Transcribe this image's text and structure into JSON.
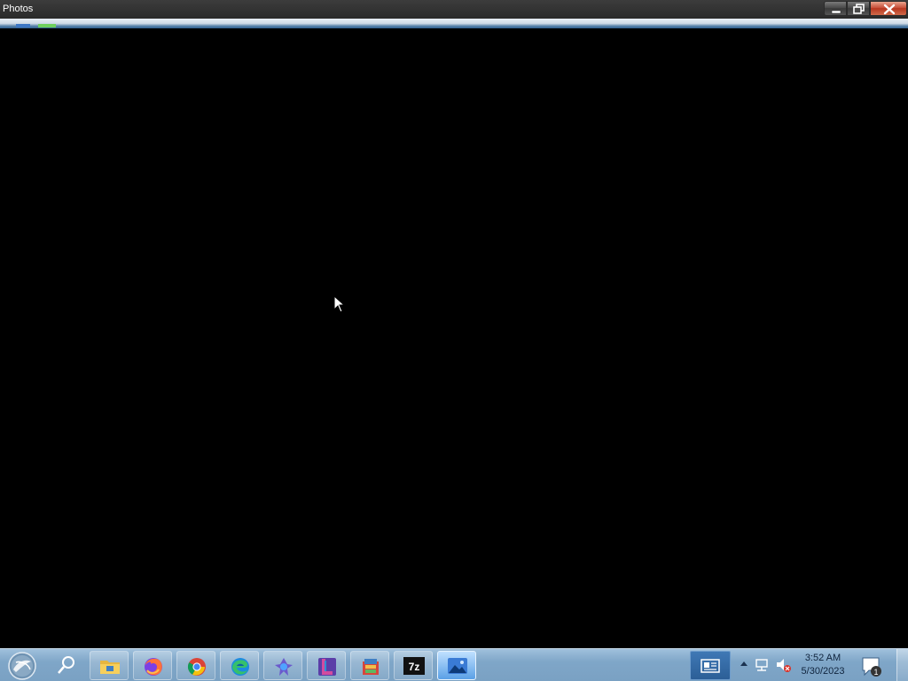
{
  "window": {
    "title": "Photos",
    "controls": [
      "minimize",
      "maximize",
      "close"
    ]
  },
  "taskbar": {
    "start_icon": "start-orb-icon",
    "search_icon": "search-icon",
    "pinned_apps": [
      {
        "name": "File Explorer",
        "icon": "folder-icon"
      },
      {
        "name": "Firefox",
        "icon": "firefox-icon"
      },
      {
        "name": "Chrome",
        "icon": "chrome-icon"
      },
      {
        "name": "Edge",
        "icon": "edge-icon"
      },
      {
        "name": "App",
        "icon": "app-logo-icon"
      },
      {
        "name": "App",
        "icon": "app-l-icon"
      },
      {
        "name": "App",
        "icon": "archive-app-icon"
      },
      {
        "name": "7z",
        "icon": "7zip-icon",
        "label": "7z"
      },
      {
        "name": "Photos",
        "icon": "photos-icon",
        "active": true
      }
    ],
    "news_icon": "news-widget-icon",
    "tray_icons": [
      "chevron-up-icon",
      "network-icon",
      "volume-muted-icon"
    ],
    "clock": {
      "time": "3:52 AM",
      "date": "5/30/2023"
    },
    "notifications": {
      "icon": "notification-icon",
      "count": "1"
    }
  },
  "colors": {
    "titlebar": "#333333",
    "taskbar": "#8cb2d4",
    "content_background": "#000000",
    "close_button": "#c8503a"
  }
}
